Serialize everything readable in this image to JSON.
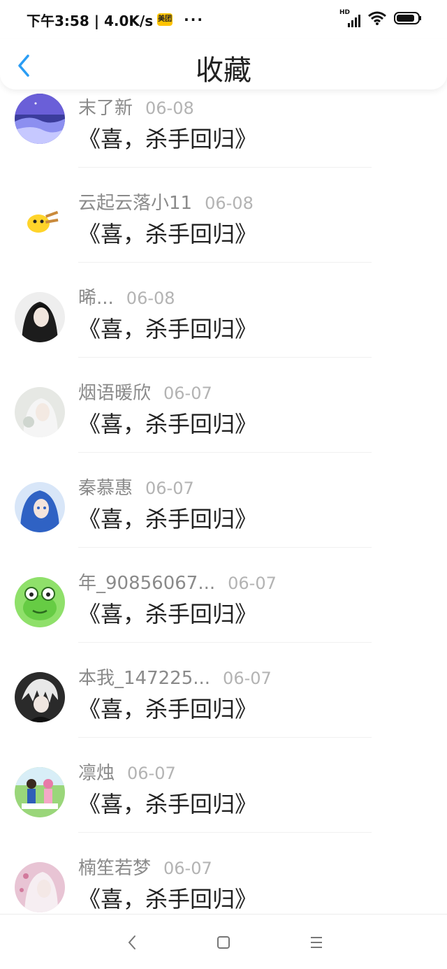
{
  "status_bar": {
    "time_speed": "下午3:58 | 4.0K/s",
    "app_badge": "美团",
    "more": "···",
    "network": "HD"
  },
  "header": {
    "title": "收藏",
    "back_icon": "chevron-left-icon"
  },
  "items": [
    {
      "username": "末了新",
      "date": "06-08",
      "content": "《喜，杀手回归》",
      "avatar_color": "#5a5fbf"
    },
    {
      "username": "云起云落小11",
      "date": "06-08",
      "content": "《喜，杀手回归》",
      "avatar_color": "#ffd42a"
    },
    {
      "username": "晞...",
      "date": "06-08",
      "content": "《喜，杀手回归》",
      "avatar_color": "#2b2b2b"
    },
    {
      "username": "烟语暖欣",
      "date": "06-07",
      "content": "《喜，杀手回归》",
      "avatar_color": "#d9dcd8"
    },
    {
      "username": "秦慕惠",
      "date": "06-07",
      "content": "《喜，杀手回归》",
      "avatar_color": "#3a6fc2"
    },
    {
      "username": "年_90856067...",
      "date": "06-07",
      "content": "《喜，杀手回归》",
      "avatar_color": "#7ed957"
    },
    {
      "username": "本我_147225...",
      "date": "06-07",
      "content": "《喜，杀手回归》",
      "avatar_color": "#3a3a3a"
    },
    {
      "username": "凛烛",
      "date": "06-07",
      "content": "《喜，杀手回归》",
      "avatar_color": "#7cc96a"
    },
    {
      "username": "楠笙若梦",
      "date": "06-07",
      "content": "《喜，杀手回归》",
      "avatar_color": "#c98aa6"
    }
  ],
  "colors": {
    "accent": "#2a9df4",
    "username": "#8a8a8a",
    "date": "#b3b3b3",
    "content": "#222222"
  },
  "nav_bar": {
    "back": "nav-back-icon",
    "home": "nav-home-icon",
    "menu": "nav-menu-icon"
  }
}
